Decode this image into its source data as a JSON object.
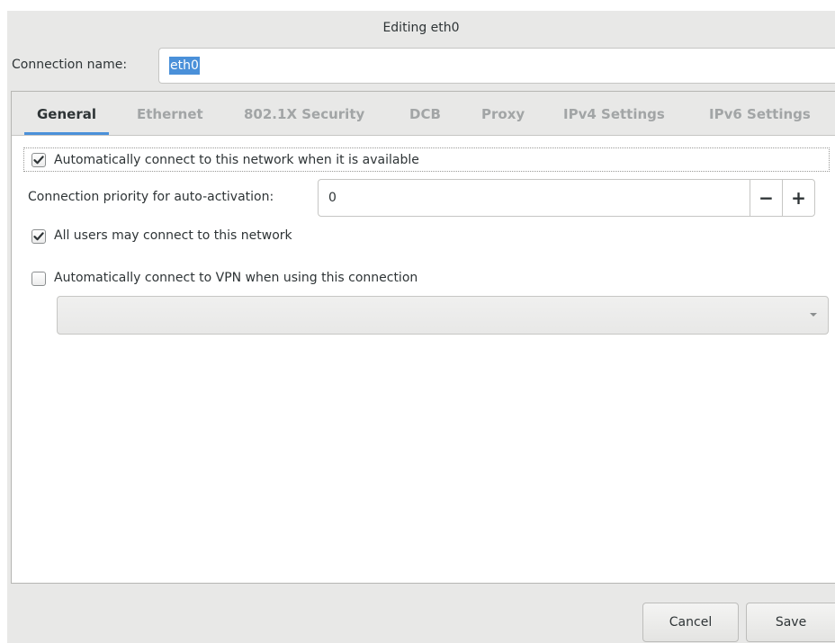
{
  "window": {
    "title": "Editing eth0"
  },
  "connection": {
    "label": "Connection name:",
    "value": "eth0"
  },
  "tabs": [
    {
      "label": "General",
      "active": true
    },
    {
      "label": "Ethernet",
      "active": false
    },
    {
      "label": "802.1X Security",
      "active": false
    },
    {
      "label": "DCB",
      "active": false
    },
    {
      "label": "Proxy",
      "active": false
    },
    {
      "label": "IPv4 Settings",
      "active": false
    },
    {
      "label": "IPv6 Settings",
      "active": false
    }
  ],
  "general": {
    "auto_connect": {
      "label": "Automatically connect to this network when it is available",
      "checked": true
    },
    "priority": {
      "label": "Connection priority for auto-activation:",
      "value": "0",
      "decrement": "−",
      "increment": "+"
    },
    "all_users": {
      "label": "All users may connect to this network",
      "checked": true
    },
    "auto_vpn": {
      "label": "Automatically connect to VPN when using this connection",
      "checked": false
    },
    "vpn_select": {
      "value": ""
    }
  },
  "buttons": {
    "cancel": "Cancel",
    "save": "Save"
  },
  "colors": {
    "accent": "#4a90d9",
    "window_bg": "#e8e8e7",
    "text": "#2e3436",
    "tab_inactive": "#a2a5a6"
  },
  "icons": {
    "check": "check-icon",
    "dropdown": "chevron-down-icon"
  }
}
